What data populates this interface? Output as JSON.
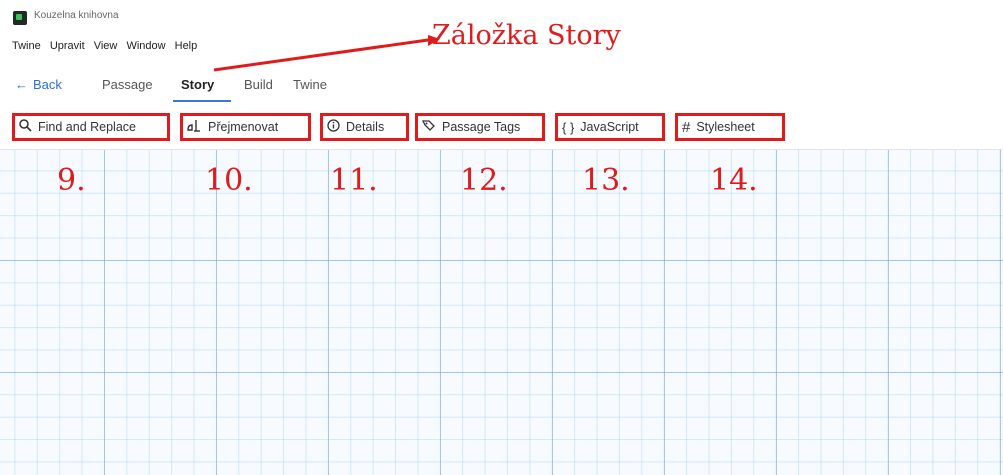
{
  "window": {
    "title": "Kouzelna knihovna"
  },
  "menubar": [
    "Twine",
    "Upravit",
    "View",
    "Window",
    "Help"
  ],
  "tabs": {
    "back": "Back",
    "items": [
      "Passage",
      "Story",
      "Build",
      "Twine"
    ],
    "active": "Story"
  },
  "toolbar": {
    "find_replace": "Find and Replace",
    "rename": "Přejmenovat",
    "details": "Details",
    "passage_tags": "Passage Tags",
    "javascript": "JavaScript",
    "stylesheet": "Stylesheet"
  },
  "annotations": {
    "title": "Záložka Story",
    "numbers": [
      "9.",
      "10.",
      "11.",
      "12.",
      "13.",
      "14."
    ],
    "color": "#e01b1b"
  },
  "icons": {
    "find_replace": "search-icon",
    "rename": "rename-icon",
    "details": "info-icon",
    "passage_tags": "tag-icon",
    "javascript": "braces-icon",
    "stylesheet": "hash-icon"
  },
  "colors": {
    "accent": "#3b78d8",
    "highlight": "#e01b1b",
    "grid": "#78aadc"
  }
}
